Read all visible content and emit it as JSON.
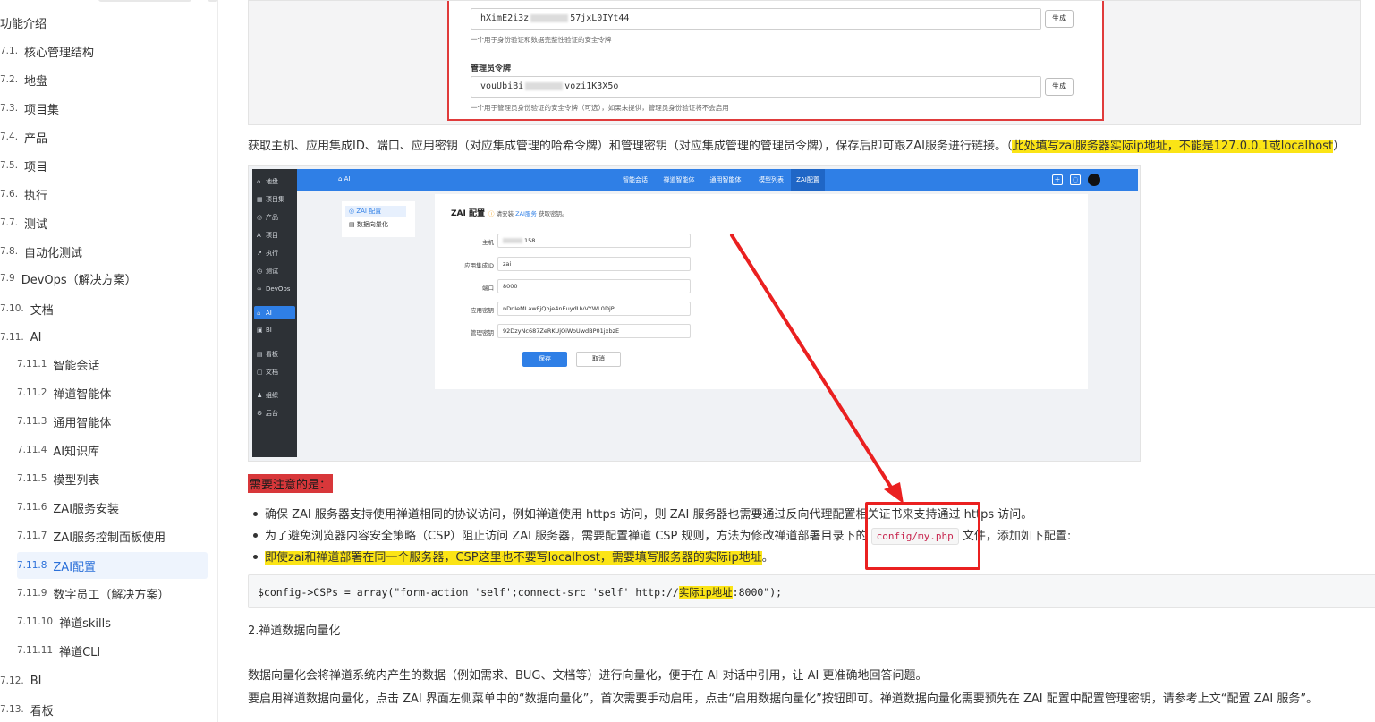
{
  "toc": {
    "items": [
      {
        "num": "",
        "label": "功能介绍"
      },
      {
        "num": "7.1.",
        "label": "核心管理结构"
      },
      {
        "num": "7.2.",
        "label": "地盘"
      },
      {
        "num": "7.3.",
        "label": "项目集"
      },
      {
        "num": "7.4.",
        "label": "产品"
      },
      {
        "num": "7.5.",
        "label": "项目"
      },
      {
        "num": "7.6.",
        "label": "执行"
      },
      {
        "num": "7.7.",
        "label": "测试"
      },
      {
        "num": "7.8.",
        "label": "自动化测试"
      },
      {
        "num": "7.9",
        "label": "DevOps（解决方案）"
      },
      {
        "num": "7.10.",
        "label": "文档"
      },
      {
        "num": "7.11.",
        "label": "AI"
      },
      {
        "num": "7.11.1",
        "label": "智能会话"
      },
      {
        "num": "7.11.2",
        "label": "禅道智能体"
      },
      {
        "num": "7.11.3",
        "label": "通用智能体"
      },
      {
        "num": "7.11.4",
        "label": "AI知识库"
      },
      {
        "num": "7.11.5",
        "label": "模型列表"
      },
      {
        "num": "7.11.6",
        "label": "ZAI服务安装"
      },
      {
        "num": "7.11.7",
        "label": "ZAI服务控制面板使用"
      },
      {
        "num": "7.11.8",
        "label": "ZAI配置"
      },
      {
        "num": "7.11.9",
        "label": "数字员工（解决方案）"
      },
      {
        "num": "7.11.10",
        "label": "禅道skills"
      },
      {
        "num": "7.11.11",
        "label": "禅道CLI"
      },
      {
        "num": "7.12.",
        "label": "BI"
      },
      {
        "num": "7.13.",
        "label": "看板"
      }
    ]
  },
  "shot1": {
    "token_prefix": "hXimE2i3z",
    "token_suffix": "57jxL0IYt44",
    "token_help": "一个用于身份验证和数据完整性验证的安全令牌",
    "admin_label": "管理员令牌",
    "admin_prefix": "vouUbiBi",
    "admin_suffix": "vozi1K3X5o",
    "admin_help": "一个用于管理员身份验证的安全令牌（可选），如果未提供，管理员身份验证将不会启用",
    "generate": "生成"
  },
  "desc": {
    "text": "获取主机、应用集成ID、端口、应用密钥（对应集成管理的哈希令牌）和管理密钥（对应集成管理的管理员令牌），保存后即可跟ZAI服务进行链接。（",
    "highlight": "此处填写zai服务器实际ip地址，不能是127.0.0.1或localhost",
    "close": "）"
  },
  "app": {
    "brand": "AI",
    "sidebar": [
      {
        "icon": "⌂",
        "label": "地盘"
      },
      {
        "icon": "▦",
        "label": "项目集"
      },
      {
        "icon": "◎",
        "label": "产品"
      },
      {
        "icon": "A",
        "label": "项目"
      },
      {
        "icon": "↗",
        "label": "执行"
      },
      {
        "icon": "◷",
        "label": "测试"
      },
      {
        "icon": "∞",
        "label": "DevOps"
      },
      {
        "icon": "⌂",
        "label": "AI"
      },
      {
        "icon": "▣",
        "label": "BI"
      },
      {
        "icon": "▤",
        "label": "看板"
      },
      {
        "icon": "▢",
        "label": "文档"
      },
      {
        "icon": "♟",
        "label": "组织"
      },
      {
        "icon": "⚙",
        "label": "后台"
      }
    ],
    "tabs": [
      "智能会话",
      "禅道智能体",
      "通用智能体",
      "模型列表",
      "ZAI配置"
    ],
    "subnav": [
      "ZAI 配置",
      "数据向量化"
    ],
    "panel_title": "ZAI 配置",
    "panel_warn": "请安装",
    "panel_link": "ZAI服务",
    "panel_warn2": "获取密钥。",
    "fields": [
      {
        "label": "主机",
        "value": "158"
      },
      {
        "label": "应用集成ID",
        "value": "zai"
      },
      {
        "label": "端口",
        "value": "8000"
      },
      {
        "label": "应用密钥",
        "value": "nDnIeMLawFjQbje4nEuydUvVYWL0DjP"
      },
      {
        "label": "管理密钥",
        "value": "92DzyNc687ZeRKUjOiWoUwdBP01jxbzE"
      }
    ],
    "save": "保存",
    "cancel": "取消"
  },
  "notes": {
    "title": "需要注意的是：",
    "b1": "确保 ZAI 服务器支持使用禅道相同的协议访问，例如禅道使用 https 访问，则 ZAI 服务器也需要通过反向代理配置相关证书来支持通过 https 访问。",
    "b2_pre": "为了避免浏览器内容安全策略（CSP）阻止访问 ZAI 服务器，需要配置禅道 CSP 规则，方法为修改禅道部署目录下的",
    "b2_code": "config/my.php",
    "b2_post": "文件，添加如下配置:",
    "b3": "即使zai和禅道部署在同一个服务器，CSP这里也不要写localhost，需要填写服务器的实际ip地址",
    "b3_end": "。"
  },
  "code": {
    "pre": "$config->CSPs = array(\"form-action 'self';connect-src 'self' http://",
    "hl": "实际ip地址",
    "post": ":8000\");"
  },
  "section2": {
    "title": "2.禅道数据向量化",
    "p1": "数据向量化会将禅道系统内产生的数据（例如需求、BUG、文档等）进行向量化，便于在 AI 对话中引用，让 AI 更准确地回答问题。",
    "p2": "要启用禅道数据向量化，点击 ZAI 界面左侧菜单中的“数据向量化”，首次需要手动启用，点击“启用数据向量化”按钮即可。禅道数据向量化需要预先在 ZAI 配置中配置管理密钥，请参考上文“配置 ZAI 服务”。"
  },
  "colors": {
    "accent": "#2f7fe6",
    "annotation": "#ea2020",
    "highlight": "#fbe416",
    "toc_active": "#2b70d9"
  }
}
